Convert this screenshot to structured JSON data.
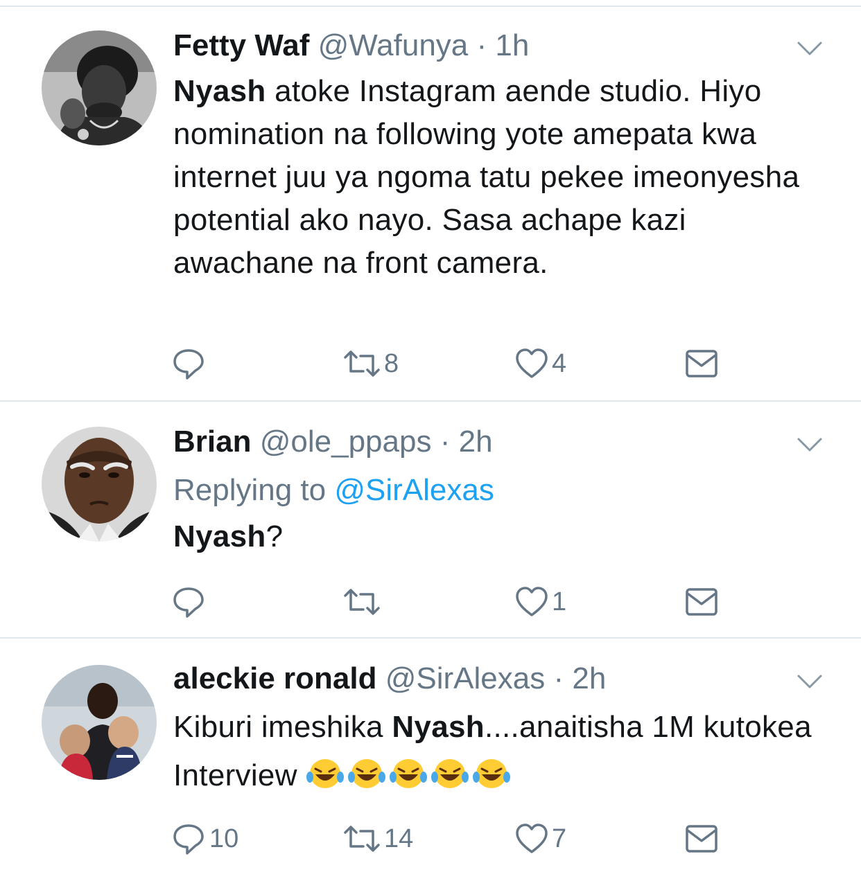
{
  "tweets": [
    {
      "name": "Fetty Waf",
      "handle": "@Wafunya",
      "separator": "·",
      "time": "1h",
      "avatar_icon": "avatar-photo-man-bw",
      "body_bold": "Nyash",
      "body_rest": " atoke Instagram aende studio. Hiyo nomination na following yote amepata kwa internet juu ya ngoma tatu pekee imeonyesha potential ako nayo. Sasa achape kazi awachane na front camera.",
      "replies": "",
      "retweets": "8",
      "likes": "4"
    },
    {
      "name": "Brian",
      "handle": "@ole_ppaps",
      "separator": "·",
      "time": "2h",
      "avatar_icon": "avatar-photo-angry-man",
      "replying_prefix": "Replying to ",
      "replying_mention": "@SirAlexas",
      "body_bold": "Nyash",
      "body_rest": "?",
      "replies": "",
      "retweets": "",
      "likes": "1"
    },
    {
      "name": "aleckie ronald",
      "handle": "@SirAlexas",
      "separator": "·",
      "time": "2h",
      "avatar_icon": "avatar-photo-man-with-babies",
      "body_pre": "Kiburi imeshika ",
      "body_bold": "Nyash",
      "body_post": "....anaitisha 1M kutokea Interview ",
      "emoji": "😂😂😂😂😂",
      "replies": "10",
      "retweets": "14",
      "likes": "7"
    }
  ],
  "colors": {
    "text": "#14171a",
    "secondary": "#657786",
    "link": "#1da1f2",
    "divider": "#e1e8ed"
  }
}
